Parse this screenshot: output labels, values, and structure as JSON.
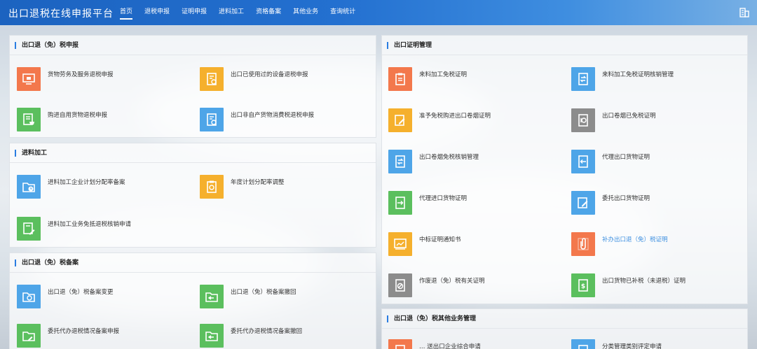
{
  "header": {
    "title": "出口退税在线申报平台",
    "nav": [
      {
        "label": "首页",
        "active": true
      },
      {
        "label": "退税申报",
        "active": false
      },
      {
        "label": "证明申报",
        "active": false
      },
      {
        "label": "进料加工",
        "active": false
      },
      {
        "label": "资格备案",
        "active": false
      },
      {
        "label": "其他业务",
        "active": false
      },
      {
        "label": "查询统计",
        "active": false
      }
    ],
    "right_icon": "building-icon"
  },
  "colors": {
    "orange": "#f3784c",
    "yellow": "#f5b02d",
    "green": "#5bbf5e",
    "blue": "#4ea5e8",
    "gray": "#8c8c8c",
    "accent": "#2a7de1",
    "link": "#3d8fe0"
  },
  "panels": {
    "export_refund": {
      "title": "出口退（免）税申报",
      "items": [
        {
          "label": "货物劳务及服务退税申报",
          "color": "orange",
          "icon": "monitor-icon"
        },
        {
          "label": "出口已使用过的设备退税申报",
          "color": "yellow",
          "icon": "document-gear-icon"
        },
        {
          "label": "购进自用货物退税申报",
          "color": "green",
          "icon": "document-cart-icon"
        },
        {
          "label": "出口非自产货物消费税退税申报",
          "color": "blue",
          "icon": "document-return-icon"
        }
      ]
    },
    "processing": {
      "title": "进料加工",
      "items": [
        {
          "label": "进料加工企业计划分配率备案",
          "color": "blue",
          "icon": "folder-clock-icon"
        },
        {
          "label": "年度计划分配率调整",
          "color": "yellow",
          "icon": "clipboard-gear-icon"
        },
        {
          "label": "进料加工业务免抵退税核销申请",
          "color": "green",
          "icon": "document-pen-icon"
        }
      ]
    },
    "filing": {
      "title": "出口退（免）税备案",
      "items": [
        {
          "label": "出口退（免）税备案变更",
          "color": "blue",
          "icon": "folder-refresh-icon"
        },
        {
          "label": "出口退（免）税备案撤回",
          "color": "green",
          "icon": "folder-back-icon"
        },
        {
          "label": "委托代办退税情况备案申报",
          "color": "green",
          "icon": "folder-pen-icon"
        },
        {
          "label": "委托代办退税情况备案撤回",
          "color": "green",
          "icon": "folder-back-icon"
        }
      ]
    },
    "certificates": {
      "title": "出口证明管理",
      "items": [
        {
          "label": "来料加工免税证明",
          "color": "orange",
          "icon": "clipboard-icon"
        },
        {
          "label": "来料加工免税证明核销管理",
          "color": "blue",
          "icon": "document-exchange-icon"
        },
        {
          "label": "准予免税购进出口卷烟证明",
          "color": "yellow",
          "icon": "document-edit-icon"
        },
        {
          "label": "出口卷烟已免税证明",
          "color": "gray",
          "icon": "document-circle-icon"
        },
        {
          "label": "出口卷烟免税核销管理",
          "color": "blue",
          "icon": "document-exchange-icon"
        },
        {
          "label": "代理出口货物证明",
          "color": "blue",
          "icon": "document-out-icon"
        },
        {
          "label": "代理进口货物证明",
          "color": "green",
          "icon": "document-in-icon"
        },
        {
          "label": "委托出口货物证明",
          "color": "blue",
          "icon": "document-edit-icon"
        },
        {
          "label": "中标证明通知书",
          "color": "yellow",
          "icon": "chart-board-icon"
        },
        {
          "label": "补办出口退（免）税证明",
          "color": "orange",
          "icon": "paperclip-icon"
        },
        {
          "label": "作废退（免）税有关证明",
          "color": "gray",
          "icon": "document-cancel-icon"
        },
        {
          "label": "出口货物已补税（未退税）证明",
          "color": "green",
          "icon": "document-dollar-icon"
        }
      ]
    },
    "other": {
      "title": "出口退（免）税其他业务管理",
      "items": [
        {
          "label": "… 送出口企业综合申请",
          "color": "orange",
          "icon": "document-icon"
        },
        {
          "label": "分类管理类别评定申请",
          "color": "blue",
          "icon": "document-icon"
        }
      ]
    }
  }
}
